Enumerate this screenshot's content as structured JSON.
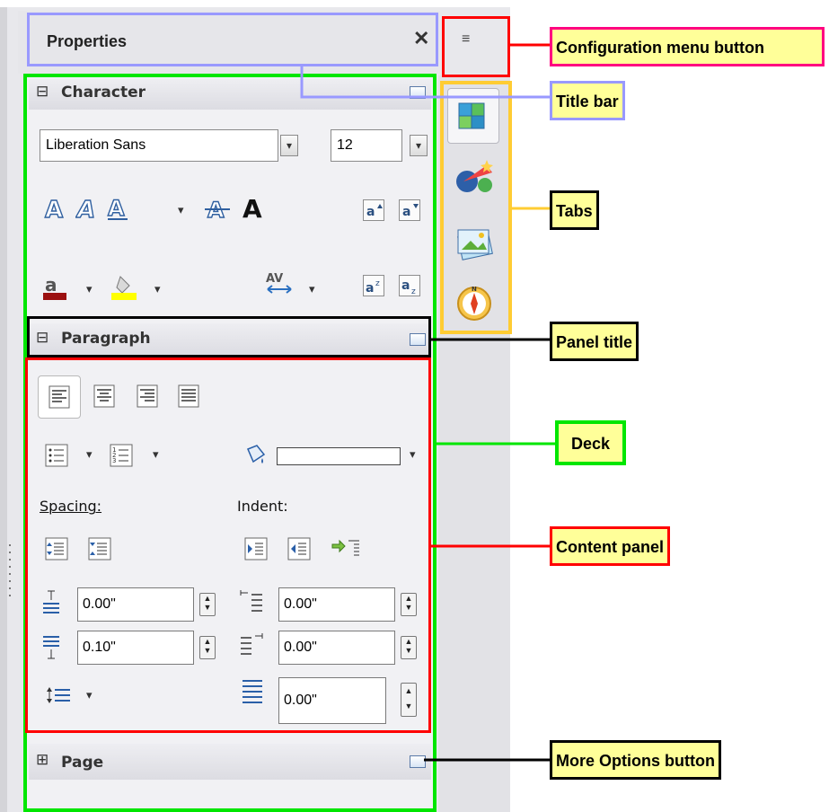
{
  "sidebar": {
    "title": "Properties",
    "close_glyph": "✕",
    "config_glyph": "≡",
    "character": {
      "expander": "⊟",
      "label": "Character",
      "font_name": "Liberation Sans",
      "font_size": "12"
    },
    "paragraph": {
      "expander": "⊟",
      "label": "Paragraph",
      "spacing_label": "Spacing:",
      "indent_label": "Indent:",
      "above_spacing": "0.00\"",
      "below_spacing": "0.10\"",
      "before_indent": "0.00\"",
      "after_indent": "0.00\"",
      "first_line_indent": "0.00\""
    },
    "page": {
      "expander": "⊞",
      "label": "Page"
    },
    "tabs": [
      "properties-tab",
      "styles-tab",
      "gallery-tab",
      "navigator-tab"
    ]
  },
  "callouts": {
    "config_menu": "Configuration menu button",
    "title_bar": "Title bar",
    "tabs": "Tabs",
    "panel_title": "Panel title",
    "deck": "Deck",
    "content_panel": "Content panel",
    "more_options": "More Options button"
  },
  "colors": {
    "config_outline": "#ff0000",
    "config_callout_border": "#ff0080",
    "title_bar_outline": "#9999ff",
    "tabs_outline": "#ffcc33",
    "panel_title_outline": "#000000",
    "deck_outline": "#00e600",
    "content_panel_outline": "#ff0000",
    "more_options_outline": "#000000"
  }
}
